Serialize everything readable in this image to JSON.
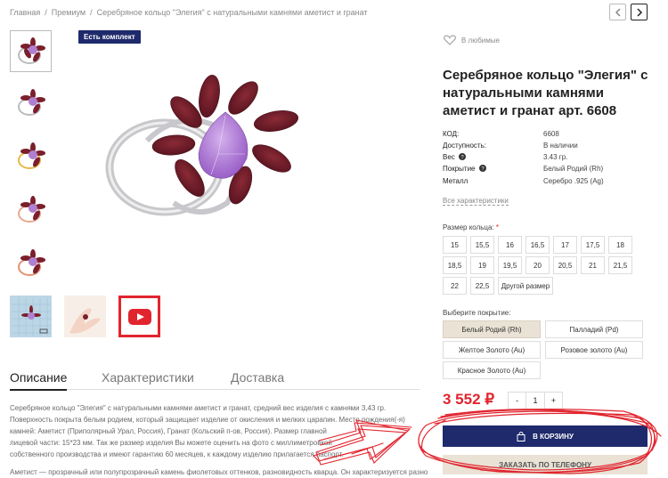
{
  "breadcrumb": [
    "Главная",
    "Премиум",
    "Серебряное кольцо \"Элегия\" с натуральными камнями аметист и гранат"
  ],
  "badge": "Есть комплект",
  "wishlist": "В любимые",
  "title": "Серебряное кольцо \"Элегия\" с натуральными камнями аметист и гранат арт. 6608",
  "specs": [
    {
      "label": "КОД:",
      "value": "6608",
      "info": false
    },
    {
      "label": "Доступность:",
      "value": "В наличии",
      "info": false
    },
    {
      "label": "Вес",
      "value": "3.43 гр.",
      "info": true
    },
    {
      "label": "Покрытие",
      "value": "Белый Родий (Rh)",
      "info": true
    },
    {
      "label": "Металл",
      "value": "Серебро .925 (Ag)",
      "info": false
    }
  ],
  "all_chars": "Все характеристики",
  "size_label": "Размер кольца:",
  "size_required": "*",
  "sizes": [
    "15",
    "15,5",
    "16",
    "16,5",
    "17",
    "17,5",
    "18",
    "18,5",
    "19",
    "19,5",
    "20",
    "20,5",
    "21",
    "21,5",
    "22",
    "22,5",
    "Другой размер"
  ],
  "coverage_label": "Выберите покрытие:",
  "coverages": [
    "Белый Родий (Rh)",
    "Палладий (Pd)",
    "Желтое Золото (Au)",
    "Розовое золото (Au)",
    "Красное Золото (Au)"
  ],
  "coverage_selected": 0,
  "price": "3 552 ₽",
  "qty": {
    "minus": "-",
    "value": "1",
    "plus": "+"
  },
  "cart_button": "В КОРЗИНУ",
  "phone_button": "ЗАКАЗАТЬ ПО ТЕЛЕФОНУ",
  "tabs": [
    "Описание",
    "Характеристики",
    "Доставка"
  ],
  "active_tab": 0,
  "description_lines": [
    "Серебряное кольцо \"Элегия\" с натуральными камнями аметист и гранат, средний вес изделия с камнями 3,43 гр.",
    "Поверхность покрыта белым родием, который защищает изделие от окисления и мелких царапин. Место рождения(-я)",
    "камней: Аметист (Приполярный Урал, Россия), Гранат (Кольский п-ов, Россия). Размер главной",
    "лицевой части: 15*23 мм. Так же размер изделия Вы можете оценить на фото с миллиметровкой",
    "собственного производства и имеют гарантию 60 месяцев, к каждому изделию прилагается паспорт.",
    "",
    "Аметист — прозрачный или полупрозрачный камень фиолетовых оттенков, разновидность кварца. Он характеризуется разно"
  ],
  "colors": {
    "navy": "#1e2a6b",
    "red": "#e1252e",
    "beige": "#e9e2d5",
    "garnet": "#7a1f2b",
    "amethyst": "#b07fd0"
  },
  "thumbnails": [
    "ring-silver-thumb",
    "ring-silver-side-thumb",
    "ring-gold-thumb",
    "ring-rose-gold-thumb",
    "ring-red-gold-thumb",
    "ring-millimeter-thumb",
    "ring-on-hand-thumb",
    "youtube-icon"
  ]
}
